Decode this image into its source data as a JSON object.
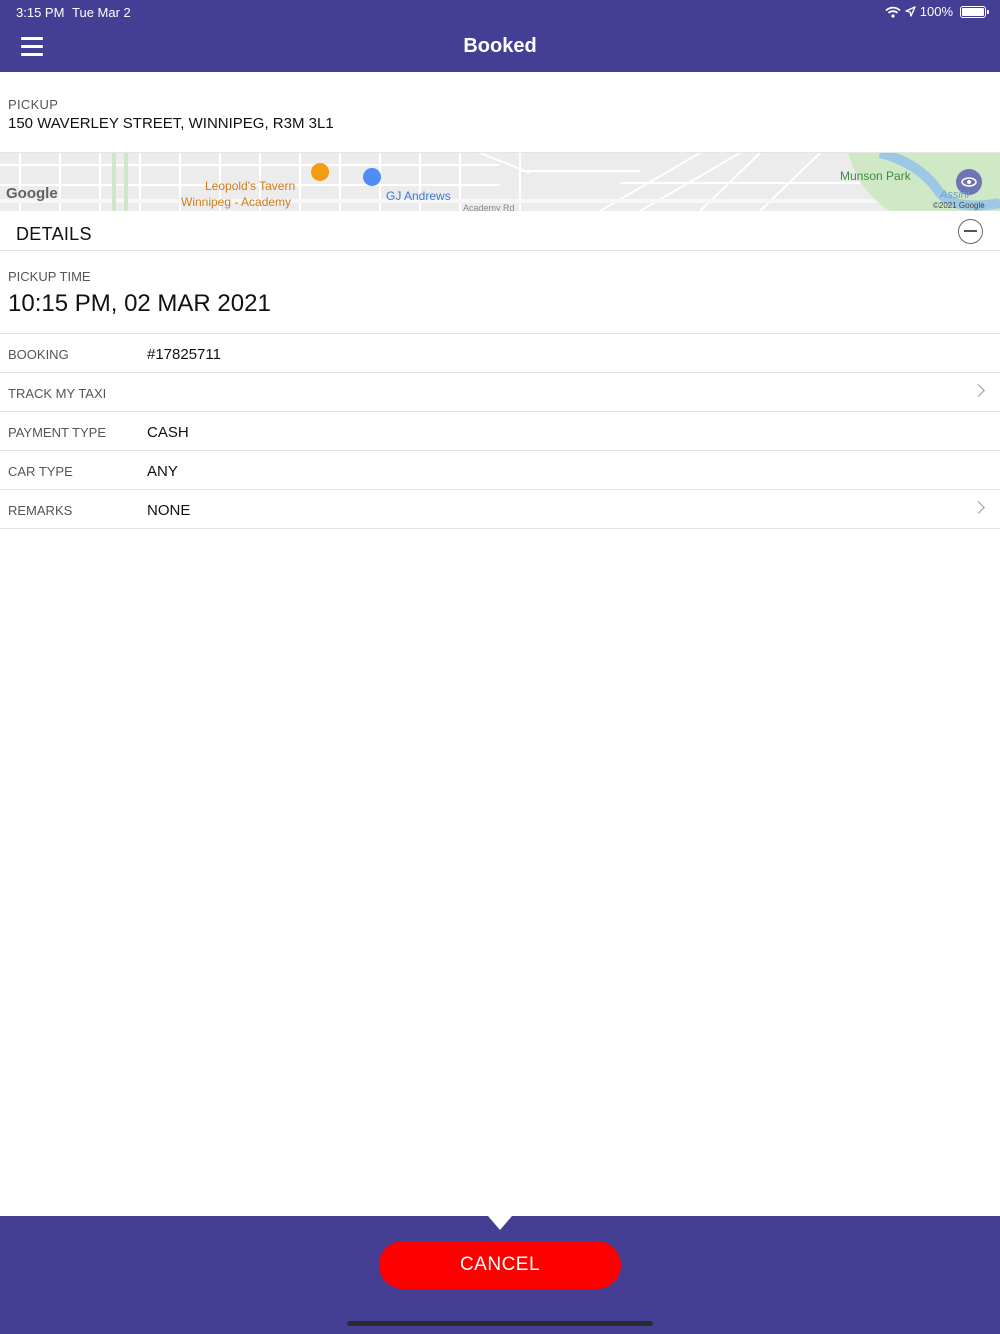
{
  "status_bar": {
    "time": "3:15 PM",
    "date": "Tue Mar 2",
    "battery": "100%"
  },
  "header": {
    "title": "Booked",
    "menu_icon": "hamburger-menu-icon"
  },
  "pickup": {
    "label": "PICKUP",
    "address": "150 WAVERLEY STREET, WINNIPEG, R3M 3L1"
  },
  "map": {
    "logo": "Google",
    "place1_line1": "Leopold's Tavern",
    "place1_line2": "Winnipeg - Academy",
    "place2": "GJ Andrews",
    "place3": "Munson Park",
    "river": "Assini",
    "copyright": "©2021 Google",
    "street": "Academy Rd"
  },
  "details": {
    "title": "DETAILS",
    "pickup_time_label": "PICKUP TIME",
    "pickup_time_value": "10:15 PM, 02 MAR 2021",
    "rows": [
      {
        "label": "BOOKING",
        "value": "#17825711"
      },
      {
        "label": "TRACK MY TAXI",
        "value": ""
      },
      {
        "label": "PAYMENT TYPE",
        "value": "CASH"
      },
      {
        "label": "CAR TYPE",
        "value": "ANY"
      },
      {
        "label": "REMARKS",
        "value": "NONE"
      }
    ]
  },
  "footer": {
    "cancel_label": "CANCEL"
  },
  "colors": {
    "brand": "#443F94",
    "cancel": "#FF0000"
  }
}
